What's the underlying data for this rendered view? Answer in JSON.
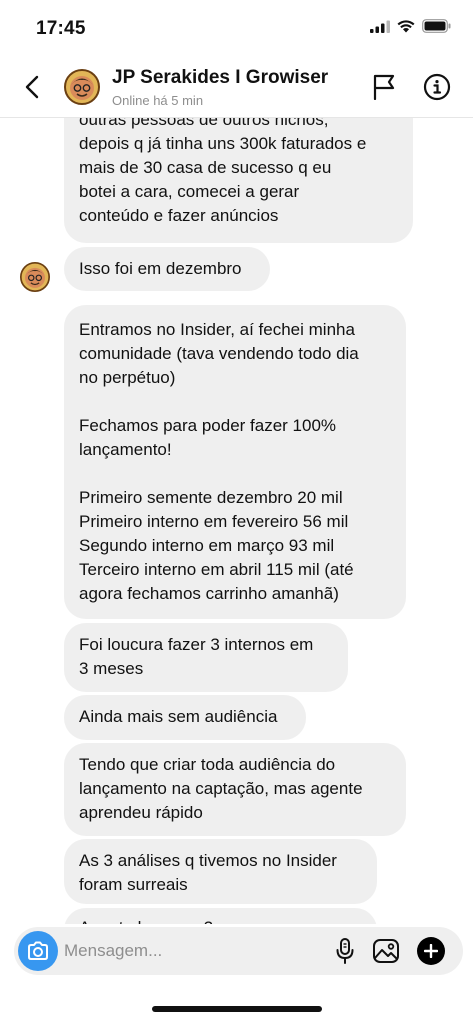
{
  "status_bar": {
    "time": "17:45"
  },
  "header": {
    "name": "JP Serakides I Growiser",
    "status": "Online há 5 min"
  },
  "messages": [
    {
      "text": "outras pessoas de outros nichos,\ndepois q já tinha uns 300k faturados e\nmais de 30 casa de sucesso q eu\nbotei a cara,  comecei a gerar\nconteúdo e fazer anúncios"
    },
    {
      "text": "Isso foi em dezembro"
    },
    {
      "text": "Entramos no Insider, aí fechei minha\ncomunidade (tava vendendo todo dia\nno perpétuo)\n\nFechamos para poder fazer 100%\nlançamento!\n\nPrimeiro semente dezembro 20 mil\nPrimeiro interno em fevereiro 56 mil\nSegundo interno em março 93 mil\nTerceiro interno em abril 115 mil (até\nagora fechamos carrinho amanhã)"
    },
    {
      "text": "Foi loucura fazer 3 internos em\n3 meses"
    },
    {
      "text": "Ainda mais sem audiência"
    },
    {
      "text": "Tendo que criar toda audiência do\nlançamento na captação, mas agente\naprendeu rápido"
    },
    {
      "text": "As 3 análises q tivemos no Insider\nforam surreais"
    },
    {
      "text": "A parte boa que 3"
    }
  ],
  "composer": {
    "placeholder": "Mensagem..."
  },
  "icons": {
    "back": "chevron-left-icon",
    "flag": "flag-icon",
    "info": "info-icon",
    "camera": "camera-icon",
    "mic": "microphone-icon",
    "gallery": "image-icon",
    "plus": "plus-icon"
  },
  "colors": {
    "bubble": "#efefef",
    "camera_button": "#3797f0",
    "secondary_text": "#8e8e8e"
  }
}
